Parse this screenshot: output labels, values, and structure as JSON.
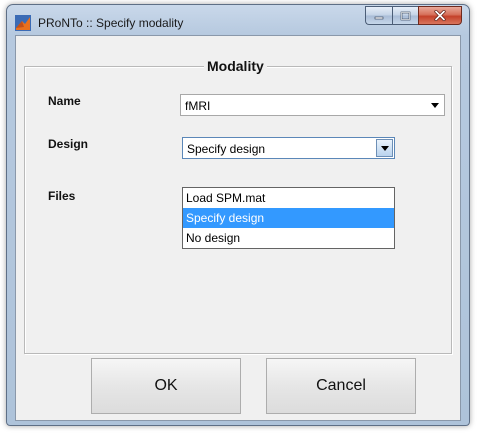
{
  "window": {
    "title": "PRoNTo :: Specify modality"
  },
  "colors": {
    "selection": "#3399ff",
    "close_button": "#c4412a",
    "app_icon": "#e8701e"
  },
  "icons": {
    "app": "matlab-logo-icon",
    "minimize": "minimize-icon",
    "maximize": "maximize-icon",
    "close": "close-icon",
    "dropdown": "chevron-down-icon"
  },
  "modality": {
    "group_title": "Modality",
    "name_label": "Name",
    "name_value": "fMRI",
    "design_label": "Design",
    "design_value": "Specify design",
    "design_options": [
      "Load SPM.mat",
      "Specify design",
      "No design"
    ],
    "files_label": "Files"
  },
  "buttons": {
    "ok": "OK",
    "cancel": "Cancel"
  }
}
